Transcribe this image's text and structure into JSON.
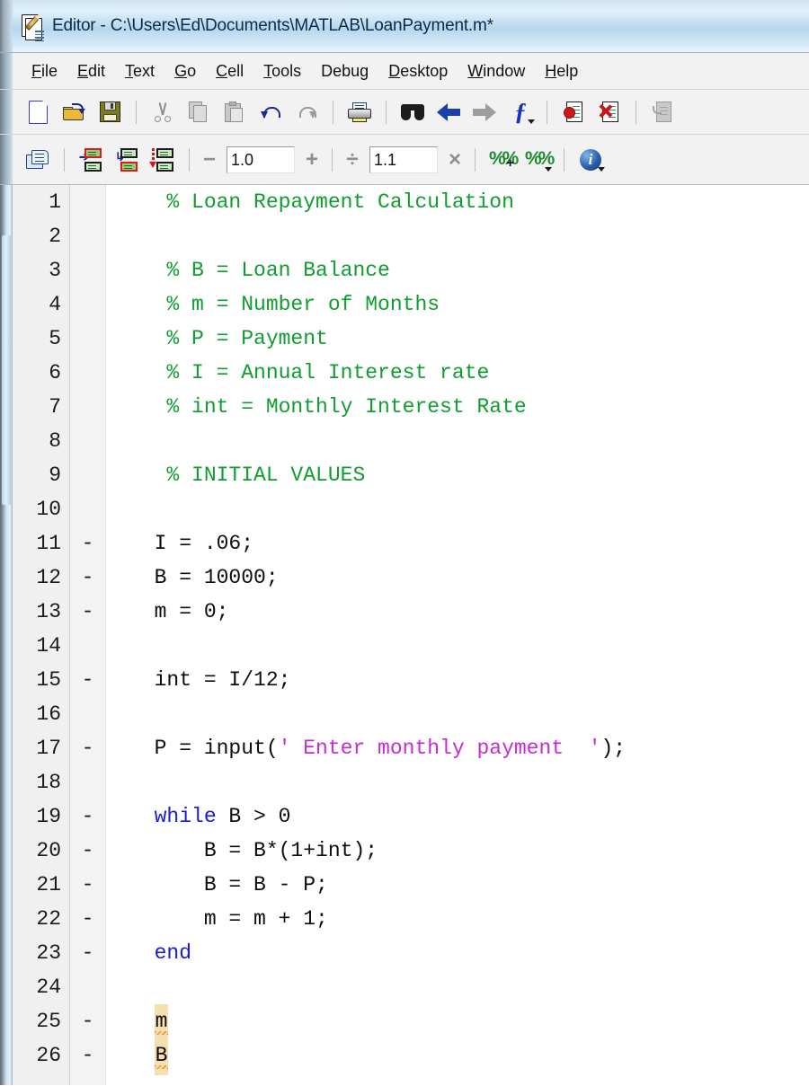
{
  "window": {
    "title": "Editor - C:\\Users\\Ed\\Documents\\MATLAB\\LoanPayment.m*",
    "icon": "editor-document-pencil-icon"
  },
  "menubar": {
    "items": [
      {
        "label": "File",
        "mnemonic": "F"
      },
      {
        "label": "Edit",
        "mnemonic": "E"
      },
      {
        "label": "Text",
        "mnemonic": "T"
      },
      {
        "label": "Go",
        "mnemonic": "G"
      },
      {
        "label": "Cell",
        "mnemonic": "C"
      },
      {
        "label": "Tools",
        "mnemonic": "T"
      },
      {
        "label": "Debug",
        "mnemonic": "g"
      },
      {
        "label": "Desktop",
        "mnemonic": "D"
      },
      {
        "label": "Window",
        "mnemonic": "W"
      },
      {
        "label": "Help",
        "mnemonic": "H"
      }
    ]
  },
  "toolbar_main": {
    "buttons": [
      {
        "name": "new-file",
        "icon": "new-document-icon"
      },
      {
        "name": "open-file",
        "icon": "open-folder-icon"
      },
      {
        "name": "save-file",
        "icon": "save-floppy-disk-icon"
      },
      {
        "name": "cut",
        "icon": "scissors-icon"
      },
      {
        "name": "copy",
        "icon": "copy-pages-icon"
      },
      {
        "name": "paste",
        "icon": "clipboard-paste-icon"
      },
      {
        "name": "undo",
        "icon": "undo-arrow-icon"
      },
      {
        "name": "redo",
        "icon": "redo-arrow-icon"
      },
      {
        "name": "print",
        "icon": "printer-icon"
      },
      {
        "name": "find",
        "icon": "binoculars-find-icon"
      },
      {
        "name": "back",
        "icon": "arrow-left-icon"
      },
      {
        "name": "forward",
        "icon": "arrow-right-icon"
      },
      {
        "name": "function-browser",
        "icon": "function-fx-icon"
      },
      {
        "name": "set-clear-breakpoint",
        "icon": "breakpoint-set-icon"
      },
      {
        "name": "clear-all-breakpoints",
        "icon": "breakpoint-clear-icon"
      },
      {
        "name": "stack-context",
        "icon": "stack-page-icon"
      }
    ]
  },
  "toolbar_cell": {
    "buttons": [
      {
        "name": "cell-mode-toggle",
        "icon": "notebook-icon"
      },
      {
        "name": "insert-cell-divider",
        "icon": "cell-insert-above-icon"
      },
      {
        "name": "insert-cell-divider-selection",
        "icon": "cell-insert-selection-icon"
      },
      {
        "name": "evaluate-next-cell",
        "icon": "cell-evaluate-next-icon"
      },
      {
        "name": "decrement-value",
        "icon": "minus-icon"
      },
      {
        "name": "increment-value",
        "icon": "plus-icon"
      },
      {
        "name": "divide-value",
        "icon": "divide-icon"
      },
      {
        "name": "multiply-value",
        "icon": "multiply-icon"
      },
      {
        "name": "add-cell-marker",
        "icon": "percent-plus-icon"
      },
      {
        "name": "cell-options",
        "icon": "percent-dropdown-icon"
      },
      {
        "name": "mlint-info",
        "icon": "info-circle-icon"
      }
    ],
    "add_sub_value": "1.0",
    "mul_div_value": "1.1",
    "symbols": {
      "minus": "−",
      "plus": "+",
      "divide": "÷",
      "multiply": "×",
      "percent": "%%",
      "plus_small": "+",
      "info": "i"
    }
  },
  "editor": {
    "lines": [
      {
        "num": "1",
        "mark": "",
        "segments": [
          {
            "t": "   % Loan Repayment Calculation",
            "c": "cm"
          }
        ]
      },
      {
        "num": "2",
        "mark": "",
        "segments": []
      },
      {
        "num": "3",
        "mark": "",
        "segments": [
          {
            "t": "   % B = Loan Balance",
            "c": "cm"
          }
        ]
      },
      {
        "num": "4",
        "mark": "",
        "segments": [
          {
            "t": "   % m = Number of Months",
            "c": "cm"
          }
        ]
      },
      {
        "num": "5",
        "mark": "",
        "segments": [
          {
            "t": "   % P = Payment",
            "c": "cm"
          }
        ]
      },
      {
        "num": "6",
        "mark": "",
        "segments": [
          {
            "t": "   % I = Annual Interest rate",
            "c": "cm"
          }
        ]
      },
      {
        "num": "7",
        "mark": "",
        "segments": [
          {
            "t": "   % int = Monthly Interest Rate",
            "c": "cm"
          }
        ]
      },
      {
        "num": "8",
        "mark": "",
        "segments": []
      },
      {
        "num": "9",
        "mark": "",
        "segments": [
          {
            "t": "   % INITIAL VALUES",
            "c": "cm"
          }
        ]
      },
      {
        "num": "10",
        "mark": "",
        "segments": []
      },
      {
        "num": "11",
        "mark": "-",
        "segments": [
          {
            "t": "  I = .06;",
            "c": ""
          }
        ]
      },
      {
        "num": "12",
        "mark": "-",
        "segments": [
          {
            "t": "  B = 10000;",
            "c": ""
          }
        ]
      },
      {
        "num": "13",
        "mark": "-",
        "segments": [
          {
            "t": "  m = 0;",
            "c": ""
          }
        ]
      },
      {
        "num": "14",
        "mark": "",
        "segments": []
      },
      {
        "num": "15",
        "mark": "-",
        "segments": [
          {
            "t": "  int = I/12;",
            "c": ""
          }
        ]
      },
      {
        "num": "16",
        "mark": "",
        "segments": []
      },
      {
        "num": "17",
        "mark": "-",
        "segments": [
          {
            "t": "  P = input(",
            "c": ""
          },
          {
            "t": "' Enter monthly payment  '",
            "c": "str"
          },
          {
            "t": ");",
            "c": ""
          }
        ]
      },
      {
        "num": "18",
        "mark": "",
        "segments": []
      },
      {
        "num": "19",
        "mark": "-",
        "segments": [
          {
            "t": "  ",
            "c": ""
          },
          {
            "t": "while",
            "c": "kw"
          },
          {
            "t": " B > 0",
            "c": ""
          }
        ]
      },
      {
        "num": "20",
        "mark": "-",
        "segments": [
          {
            "t": "      B = B*(1+int);",
            "c": ""
          }
        ]
      },
      {
        "num": "21",
        "mark": "-",
        "segments": [
          {
            "t": "      B = B - P;",
            "c": ""
          }
        ]
      },
      {
        "num": "22",
        "mark": "-",
        "segments": [
          {
            "t": "      m = m + 1;",
            "c": ""
          }
        ]
      },
      {
        "num": "23",
        "mark": "-",
        "segments": [
          {
            "t": "  ",
            "c": ""
          },
          {
            "t": "end",
            "c": "kw"
          }
        ]
      },
      {
        "num": "24",
        "mark": "",
        "segments": []
      },
      {
        "num": "25",
        "mark": "-",
        "segments": [
          {
            "t": "  ",
            "c": ""
          },
          {
            "t": "m",
            "c": "warn"
          }
        ]
      },
      {
        "num": "26",
        "mark": "-",
        "segments": [
          {
            "t": "  ",
            "c": ""
          },
          {
            "t": "B",
            "c": "warn"
          }
        ]
      }
    ]
  },
  "colors": {
    "comment_green": "#0f9d2f",
    "keyword_blue": "#1a1ad8",
    "string_magenta": "#c72ad4",
    "warning_highlight": "#f5deb0",
    "warning_squiggle": "#e8a63a",
    "title_gradient_blue": "#cfe3f2",
    "toolbar_bg": "#f2f2f2",
    "gutter_bg": "#f0f0f0"
  }
}
